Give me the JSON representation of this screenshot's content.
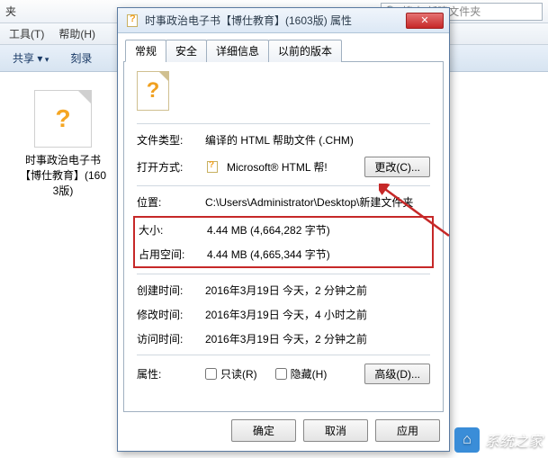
{
  "explorer": {
    "crumb_suffix": "夹",
    "refresh_icon": "↻",
    "search_icon": "🔍",
    "search_placeholder": "搜索 新建文件夹",
    "menu": {
      "tools": "工具(T)",
      "help": "帮助(H)"
    },
    "cmd": {
      "share": "共享 ▾",
      "burn": "刻录"
    },
    "file": {
      "name": "时事政治电子书【博仕教育】(1603版)"
    }
  },
  "dialog": {
    "title": "时事政治电子书【博仕教育】(1603版) 属性",
    "close": "✕",
    "tabs": {
      "general": "常规",
      "security": "安全",
      "details": "详细信息",
      "previous": "以前的版本"
    },
    "labels": {
      "filetype": "文件类型:",
      "openwith": "打开方式:",
      "location": "位置:",
      "size": "大小:",
      "sizeondisk": "占用空间:",
      "created": "创建时间:",
      "modified": "修改时间:",
      "accessed": "访问时间:",
      "attributes": "属性:"
    },
    "values": {
      "filetype": "编译的 HTML 帮助文件 (.CHM)",
      "openwith": "Microsoft® HTML 帮!",
      "location": "C:\\Users\\Administrator\\Desktop\\新建文件夹",
      "size": "4.44 MB (4,664,282 字节)",
      "sizeondisk": "4.44 MB (4,665,344 字节)",
      "created": "2016年3月19日 今天，2 分钟之前",
      "modified": "2016年3月19日 今天，4 小时之前",
      "accessed": "2016年3月19日 今天，2 分钟之前"
    },
    "buttons": {
      "change": "更改(C)...",
      "advanced": "高级(D)...",
      "ok": "确定",
      "cancel": "取消",
      "apply": "应用"
    },
    "checkboxes": {
      "readonly": "只读(R)",
      "hidden": "隐藏(H)"
    }
  },
  "watermark": {
    "text": "系统之家",
    "logo": "⌂"
  }
}
